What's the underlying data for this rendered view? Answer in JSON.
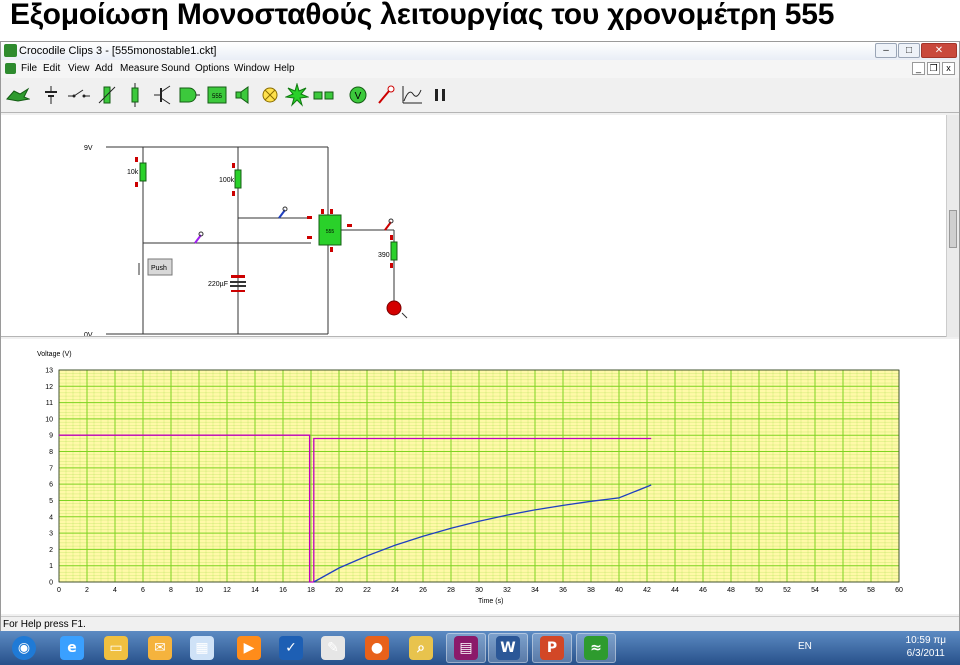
{
  "slide": {
    "title": "Εξομοίωση Μονοσταθούς  λειτουργίας του χρονομέτρη 555"
  },
  "window": {
    "title": "Crocodile Clips 3 - [555monostable1.ckt]",
    "buttons": {
      "minimize": "–",
      "maximize": "□",
      "close": "✕"
    }
  },
  "menu": {
    "items": [
      "File",
      "Edit",
      "View",
      "Add",
      "Measure",
      "Sound",
      "Options",
      "Window",
      "Help"
    ]
  },
  "mdi_buttons": {
    "minimize": "_",
    "restore": "❐",
    "close": "x"
  },
  "toolbar": {
    "tools": [
      "crocodile-icon",
      "power-supply-icon",
      "switch-icon",
      "variable-resistor-icon",
      "resistor-icon",
      "transistor-icon",
      "logic-gate-icon",
      "ic-555-icon",
      "speaker-icon",
      "lamp-icon",
      "bulb-icon",
      "connector-icon",
      "voltmeter-icon",
      "probe-icon",
      "graph-icon",
      "pause-icon"
    ],
    "ic_label": "555"
  },
  "circuit": {
    "labels": {
      "supply": "9V",
      "ground": "0V",
      "r1": "10k",
      "r2": "100k",
      "cap": "220µF",
      "r3": "390",
      "push": "Push",
      "chip": "555"
    }
  },
  "chart_data": {
    "type": "line",
    "ylabel": "Voltage (V)",
    "xlabel": "Time (s)",
    "xlim": [
      0,
      60
    ],
    "ylim": [
      0,
      13
    ],
    "xticks": [
      0,
      2,
      4,
      6,
      8,
      10,
      12,
      14,
      16,
      18,
      20,
      22,
      24,
      26,
      28,
      30,
      32,
      34,
      36,
      38,
      40,
      42,
      44,
      46,
      48,
      50,
      52,
      54,
      56,
      58,
      60
    ],
    "yticks": [
      0,
      1,
      2,
      3,
      4,
      5,
      6,
      7,
      8,
      9,
      10,
      11,
      12,
      13
    ],
    "grid": true,
    "background": "#fff9a8",
    "grid_color": "#7ed321",
    "series": [
      {
        "color": "#c000c0",
        "x": [
          0,
          17.9,
          17.9,
          18.2,
          18.2,
          42.3
        ],
        "y": [
          9,
          9,
          0,
          0,
          8.8,
          8.8
        ]
      },
      {
        "color": "#2040c0",
        "x": [
          18.2,
          20,
          22,
          24,
          26,
          28,
          30,
          32,
          34,
          36,
          38,
          40,
          42.3
        ],
        "y": [
          0,
          0.86,
          1.6,
          2.25,
          2.81,
          3.3,
          3.73,
          4.1,
          4.42,
          4.7,
          4.95,
          5.16,
          5.95
        ]
      }
    ]
  },
  "status": {
    "text": "For Help press F1."
  },
  "taskbar": {
    "apps": [
      "start-orb-icon",
      "internet-explorer-icon",
      "file-explorer-icon",
      "outlook-icon",
      "calculator-icon",
      "media-icon",
      "checkmark-app-icon",
      "paint-icon",
      "firefox-icon",
      "search-app-icon",
      "winrar-icon",
      "word-icon",
      "powerpoint-icon",
      "crocodile-clips-icon"
    ],
    "tray": {
      "language": "EN",
      "time": "10:59 πμ",
      "date": "6/3/2011"
    }
  }
}
